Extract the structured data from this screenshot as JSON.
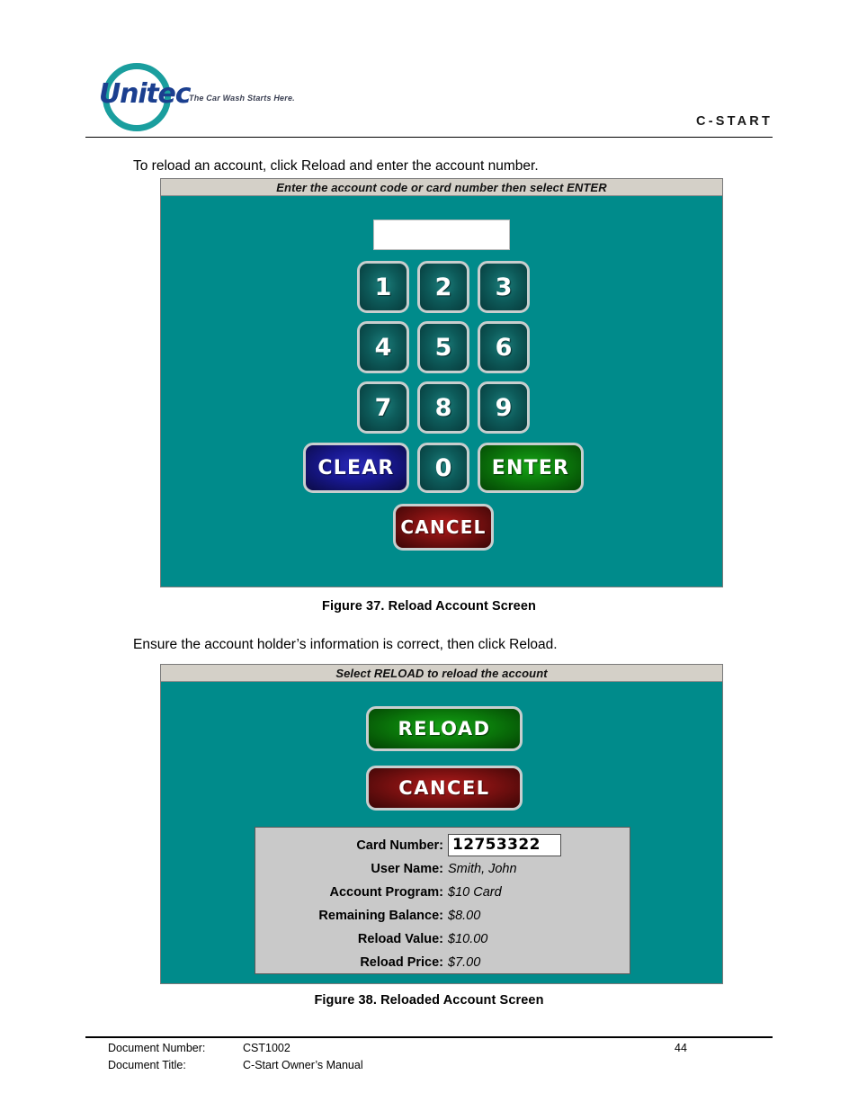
{
  "header": {
    "logo_word": "Unitec",
    "logo_tagline": "The Car Wash Starts Here.",
    "doc_title_right": "C-START",
    "teal": "#008B8B",
    "logo_blue": "#1b3f8f",
    "logo_teal": "#1a9e9e"
  },
  "paragraphs": {
    "intro": "To reload an account, click Reload and enter the account number.",
    "confirm": "Ensure the account holder’s information is correct, then click Reload."
  },
  "figure37": {
    "caption": "Figure 37. Reload Account Screen",
    "titlebar": "Enter the account code or card number then select ENTER",
    "entry_value": "",
    "keys": [
      {
        "id": "1",
        "label": "1"
      },
      {
        "id": "2",
        "label": "2"
      },
      {
        "id": "3",
        "label": "3"
      },
      {
        "id": "4",
        "label": "4"
      },
      {
        "id": "5",
        "label": "5"
      },
      {
        "id": "6",
        "label": "6"
      },
      {
        "id": "7",
        "label": "7"
      },
      {
        "id": "8",
        "label": "8"
      },
      {
        "id": "9",
        "label": "9"
      },
      {
        "id": "0",
        "label": "0"
      }
    ],
    "clear_label": "CLEAR",
    "enter_label": "ENTER",
    "cancel_label": "CANCEL",
    "colors": {
      "clear": "#1818 90",
      "enter": "#0c7a0c",
      "cancel": "#7d1111",
      "numeric": "#0d5b5a"
    }
  },
  "figure38": {
    "caption": "Figure 38. Reloaded Account Screen",
    "titlebar": "Select RELOAD to reload the account",
    "reload_label": "RELOAD",
    "cancel_label": "CANCEL",
    "info_rows": [
      {
        "label": "Card Number:",
        "value": "12753322",
        "boxed": true
      },
      {
        "label": "User Name:",
        "value": "Smith, John",
        "boxed": false
      },
      {
        "label": "Account Program:",
        "value": "$10 Card",
        "boxed": false
      },
      {
        "label": "Remaining Balance:",
        "value": "$8.00",
        "boxed": false
      },
      {
        "label": "Reload Value:",
        "value": "$10.00",
        "boxed": false
      },
      {
        "label": "Reload Price:",
        "value": "$7.00",
        "boxed": false
      }
    ]
  },
  "footer": {
    "doc_number_label": "Document Number:",
    "doc_number_value": "CST1002",
    "doc_title_label": "Document Title:",
    "doc_title_value": "C-Start Owner’s Manual",
    "page_number": "44"
  }
}
